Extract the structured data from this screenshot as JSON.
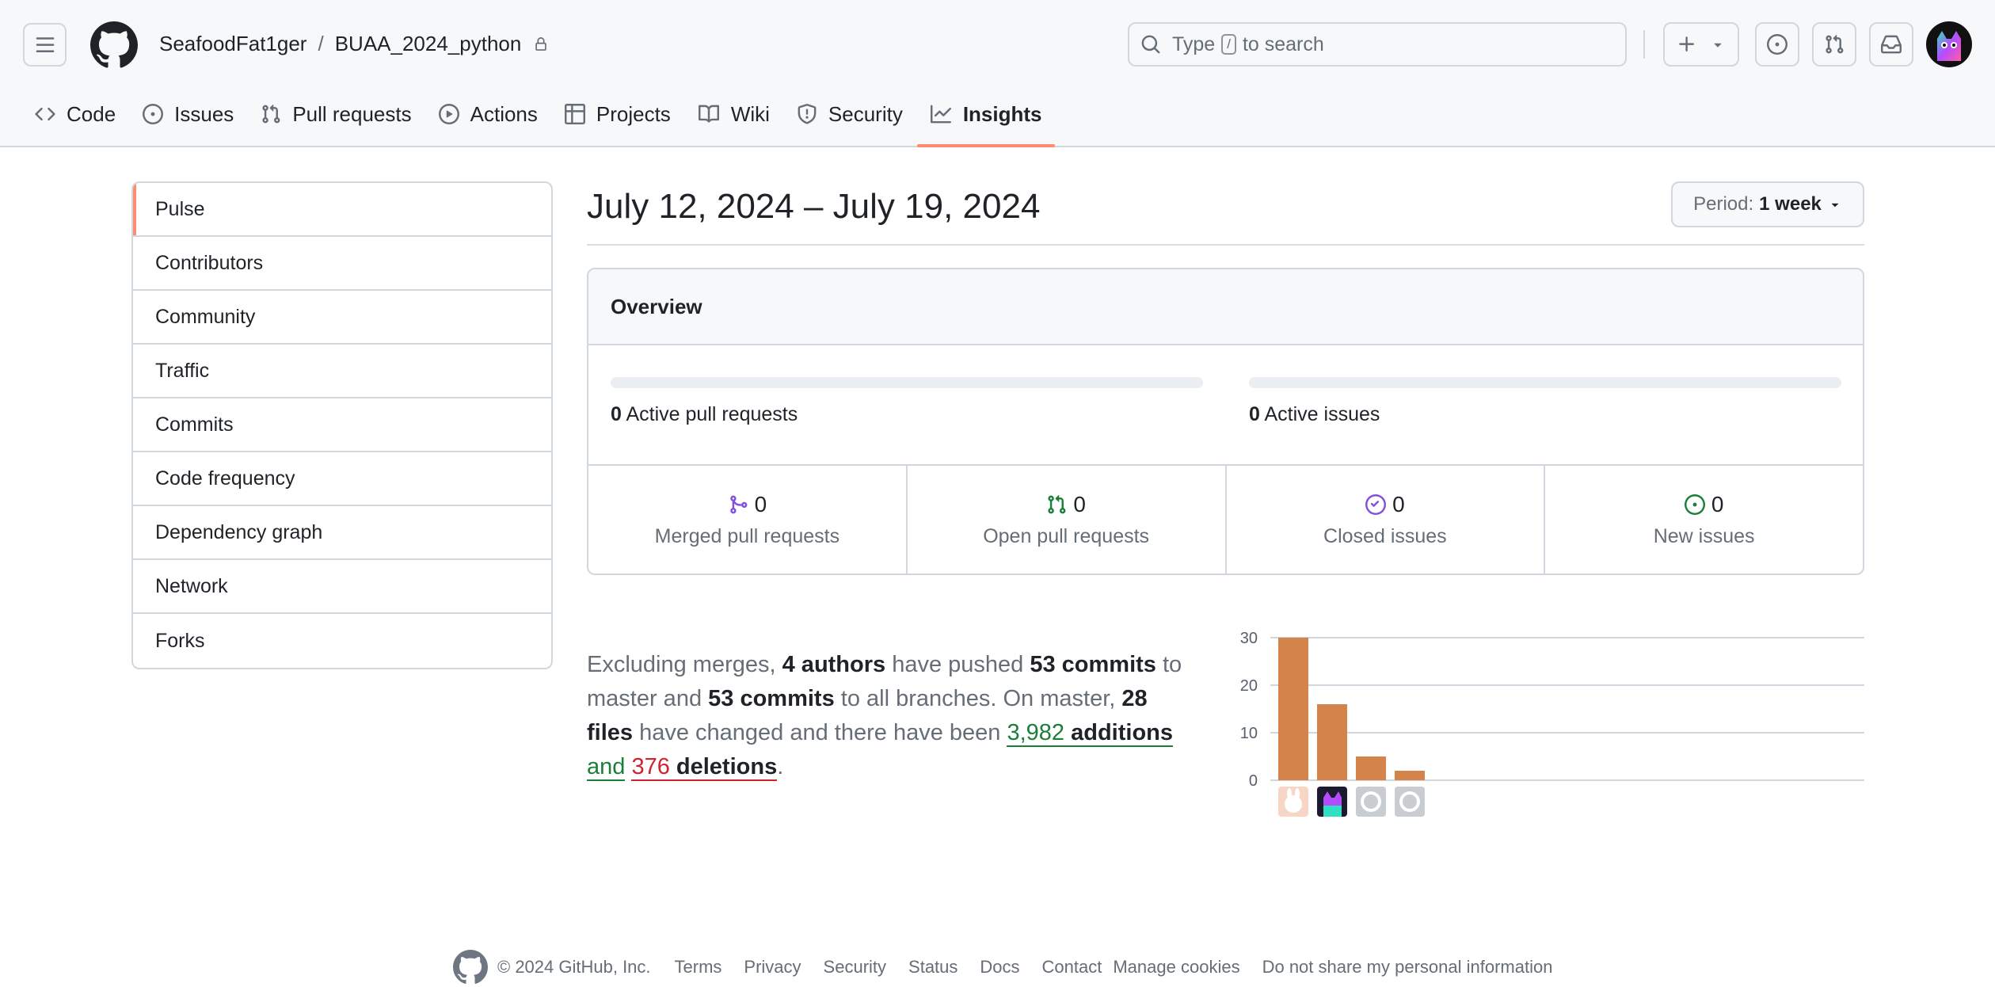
{
  "header": {
    "owner": "SeafoodFat1ger",
    "separator": "/",
    "repo": "BUAA_2024_python",
    "search": {
      "prefix": "Type",
      "key": "/",
      "suffix": "to search"
    }
  },
  "tabs": [
    {
      "label": "Code",
      "icon": "code-icon"
    },
    {
      "label": "Issues",
      "icon": "issue-icon"
    },
    {
      "label": "Pull requests",
      "icon": "pull-request-icon"
    },
    {
      "label": "Actions",
      "icon": "play-icon"
    },
    {
      "label": "Projects",
      "icon": "table-icon"
    },
    {
      "label": "Wiki",
      "icon": "book-icon"
    },
    {
      "label": "Security",
      "icon": "shield-icon"
    },
    {
      "label": "Insights",
      "icon": "graph-icon",
      "active": true
    }
  ],
  "sidebar": {
    "items": [
      {
        "label": "Pulse",
        "selected": true
      },
      {
        "label": "Contributors"
      },
      {
        "label": "Community"
      },
      {
        "label": "Traffic"
      },
      {
        "label": "Commits"
      },
      {
        "label": "Code frequency"
      },
      {
        "label": "Dependency graph"
      },
      {
        "label": "Network"
      },
      {
        "label": "Forks"
      }
    ]
  },
  "main": {
    "date_range": "July 12, 2024 – July 19, 2024",
    "period": {
      "label": "Period:",
      "value": "1 week"
    },
    "overview": {
      "title": "Overview",
      "active_prs": {
        "count": "0",
        "label": "Active pull requests"
      },
      "active_issues": {
        "count": "0",
        "label": "Active issues"
      },
      "stats": [
        {
          "value": "0",
          "label": "Merged pull requests",
          "icon": "merge-icon",
          "color": "#8250df"
        },
        {
          "value": "0",
          "label": "Open pull requests",
          "icon": "pull-request-icon",
          "color": "#1a7f37"
        },
        {
          "value": "0",
          "label": "Closed issues",
          "icon": "issue-closed-icon",
          "color": "#8250df"
        },
        {
          "value": "0",
          "label": "New issues",
          "icon": "issue-opened-icon",
          "color": "#1a7f37"
        }
      ]
    },
    "summary": {
      "t1": "Excluding merges, ",
      "authors": "4 authors",
      "t2": " have pushed ",
      "commits_master": "53 commits",
      "t3": " to master and ",
      "commits_all": "53 commits",
      "t4": " to all branches. On master, ",
      "files": "28 files",
      "t5": " have changed and there have been ",
      "additions_num": "3,982",
      "additions_word": "additions",
      "t6": " and",
      "deletions_num": "376",
      "deletions_word": "deletions",
      "t7": "."
    }
  },
  "chart_data": {
    "type": "bar",
    "categories": [
      "author-1",
      "author-2",
      "author-3",
      "author-4"
    ],
    "values": [
      30,
      16,
      5,
      2
    ],
    "ylim": [
      0,
      30
    ],
    "yticks": [
      0,
      10,
      20,
      30
    ],
    "bar_color": "#d4834a",
    "grid": true
  },
  "footer": {
    "copyright": "© 2024 GitHub, Inc.",
    "links": [
      "Terms",
      "Privacy",
      "Security",
      "Status",
      "Docs",
      "Contact",
      "Manage cookies",
      "Do not share my personal information"
    ]
  },
  "colors": {
    "accent": "#fd8c73",
    "green": "#1a7f37",
    "purple": "#8250df",
    "red": "#cf222e"
  }
}
